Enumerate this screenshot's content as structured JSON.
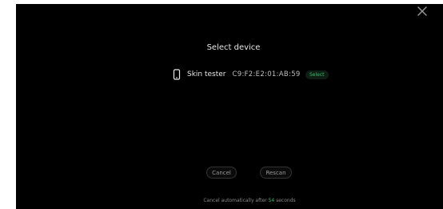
{
  "dialog": {
    "title": "Select device",
    "close_icon": "close-icon"
  },
  "device": {
    "icon": "phone-icon",
    "name": "Skin tester",
    "mac": "C9:F2:E2:01:AB:59",
    "select_label": "Select"
  },
  "actions": {
    "cancel_label": "Cancel",
    "rescan_label": "Rescan"
  },
  "footer": {
    "prefix": "Cancel automatically after",
    "seconds": "54",
    "suffix": "seconds"
  },
  "colors": {
    "background": "#000000",
    "accent": "#2fbf6a",
    "text": "#e6e6e6"
  }
}
